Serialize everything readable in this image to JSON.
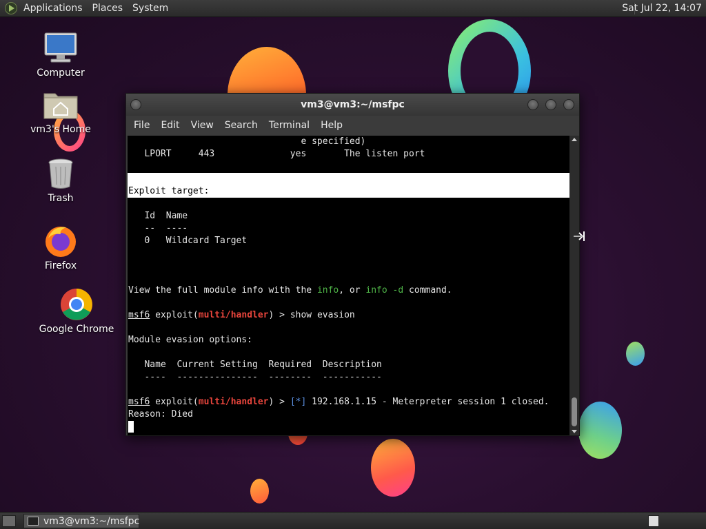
{
  "top_panel": {
    "menus": [
      "Applications",
      "Places",
      "System"
    ],
    "clock": "Sat Jul 22, 14:07"
  },
  "desktop_icons": [
    {
      "label": "Computer",
      "icon": "computer-icon"
    },
    {
      "label": "vm3's Home",
      "icon": "home-folder-icon"
    },
    {
      "label": "Trash",
      "icon": "trash-icon"
    },
    {
      "label": "Firefox",
      "icon": "firefox-icon"
    },
    {
      "label": "Google Chrome",
      "icon": "chrome-icon"
    }
  ],
  "terminal": {
    "title": "vm3@vm3:~/msfpc",
    "menu": [
      "File",
      "Edit",
      "View",
      "Search",
      "Terminal",
      "Help"
    ],
    "lines": {
      "l0": "                                e specified)",
      "l1": "   LPORT     443              yes       The listen port",
      "l4": "Exploit target:",
      "l6": "   Id  Name",
      "l7": "   --  ----",
      "l8": "   0   Wildcard Target",
      "l12_a": "View the full module info with the ",
      "l12_b": "info",
      "l12_c": ", or ",
      "l12_d": "info -d",
      "l12_e": " command.",
      "prompt_msf": "msf6",
      "prompt_exploit": " exploit(",
      "prompt_module": "multi/handler",
      "prompt_close": ") > ",
      "l14_cmd": "show evasion",
      "l16": "Module evasion options:",
      "l18": "   Name  Current Setting  Required  Description",
      "l19": "   ----  ---------------  --------  -----------",
      "l21_star": "[*]",
      "l21_rest": " 192.168.1.15 - Meterpreter session 1 closed.",
      "l22": "Reason: Died"
    }
  },
  "taskbar": {
    "task_label": "vm3@vm3:~/msfpc"
  }
}
